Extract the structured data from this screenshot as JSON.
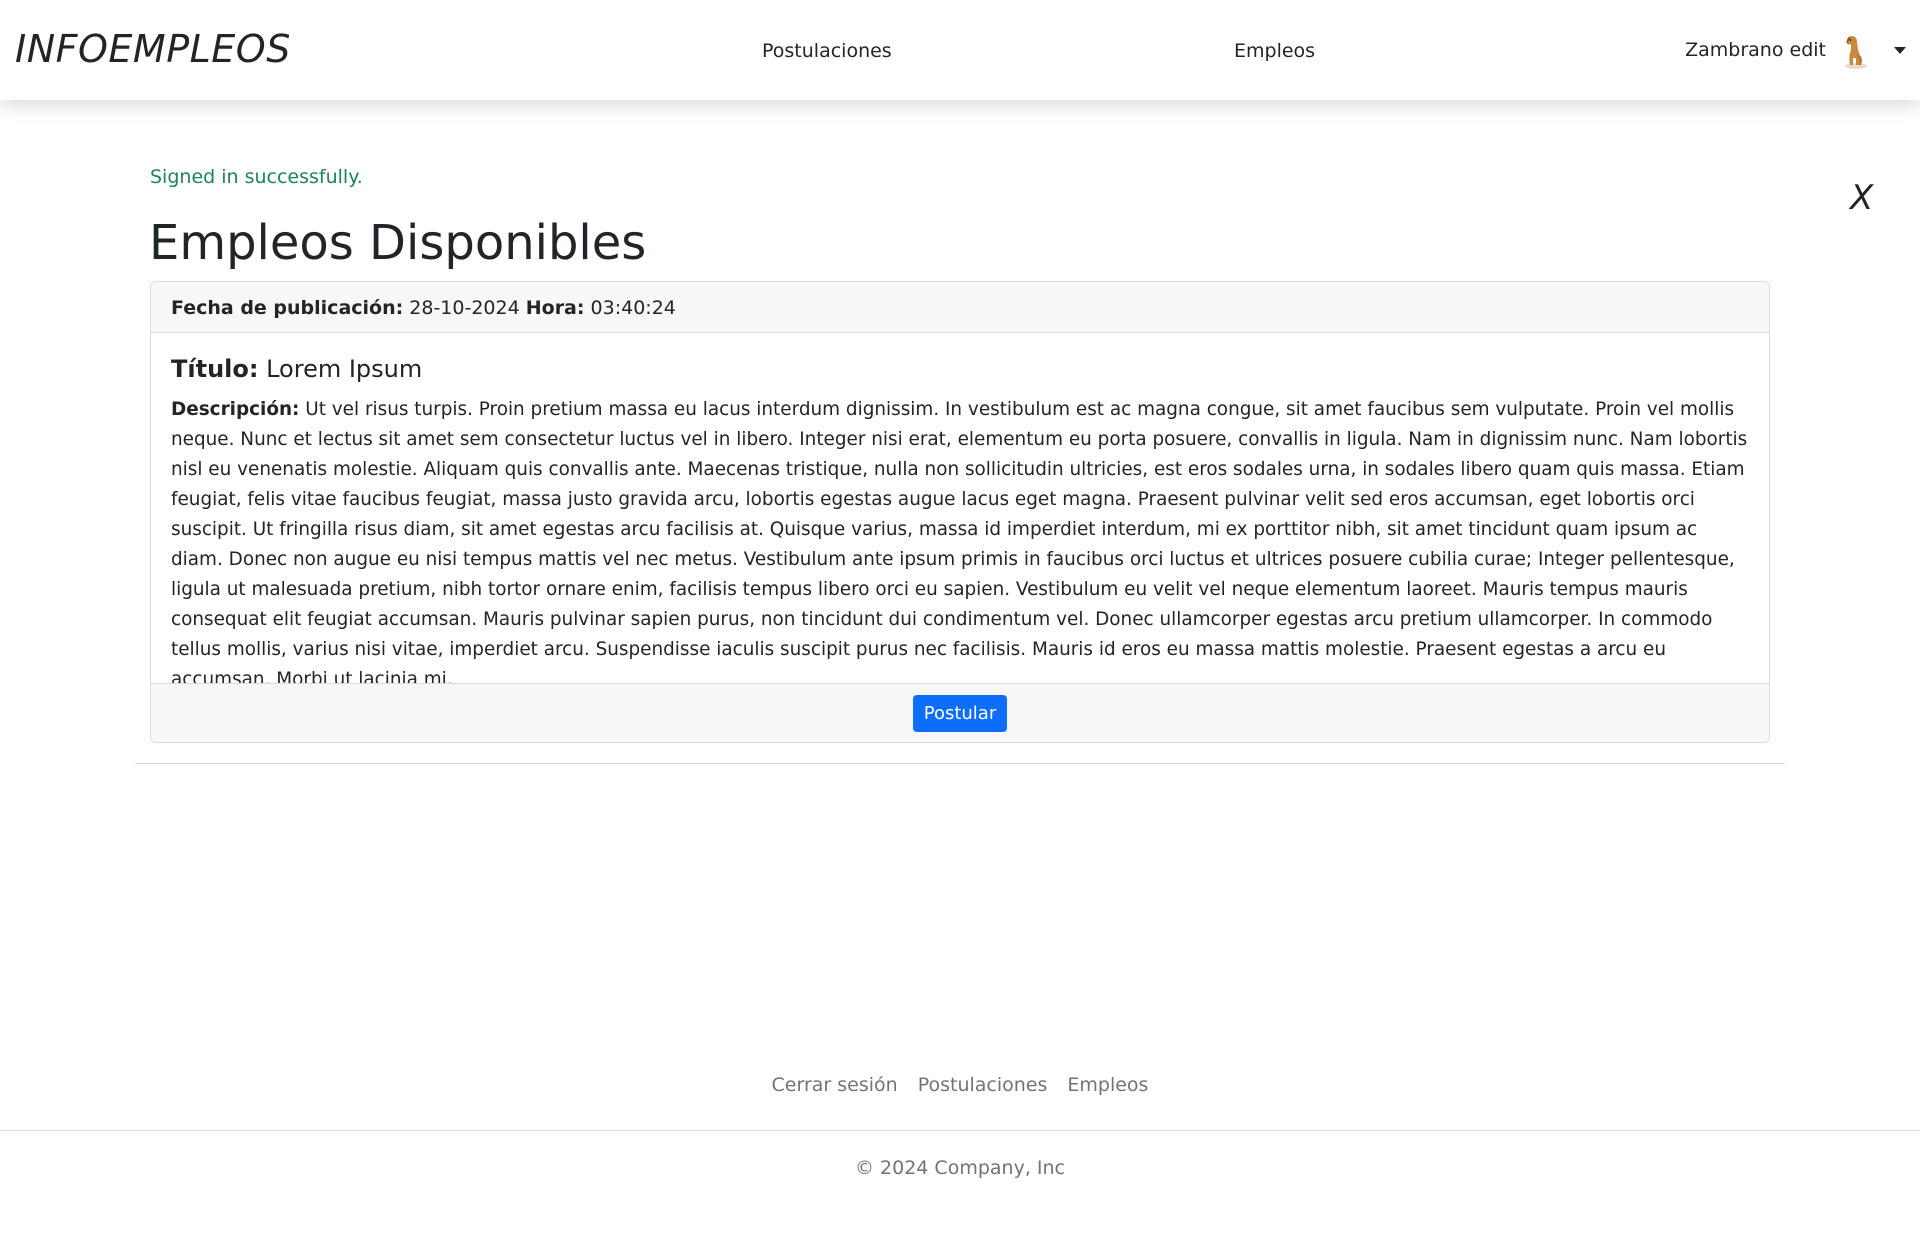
{
  "navbar": {
    "brand": "INFOEMPLEOS",
    "links": [
      "Postulaciones",
      "Empleos"
    ],
    "user_name": "Zambrano edit",
    "avatar_icon": "dog-avatar-icon",
    "caret_icon": "caret-down-icon"
  },
  "flash": {
    "message": "Signed in successfully.",
    "close_label": "X",
    "color": "#198754"
  },
  "page": {
    "title": "Empleos Disponibles"
  },
  "job": {
    "date_label": "Fecha de publicación:",
    "date_value": "28-10-2024",
    "time_label": "Hora:",
    "time_value": "03:40:24",
    "title_label": "Título:",
    "title_value": "Lorem Ipsum",
    "desc_label": "Descripción:",
    "desc_value": "Ut vel risus turpis. Proin pretium massa eu lacus interdum dignissim. In vestibulum est ac magna congue, sit amet faucibus sem vulputate. Proin vel mollis neque. Nunc et lectus sit amet sem consectetur luctus vel in libero. Integer nisi erat, elementum eu porta posuere, convallis in ligula. Nam in dignissim nunc. Nam lobortis nisl eu venenatis molestie. Aliquam quis convallis ante. Maecenas tristique, nulla non sollicitudin ultricies, est eros sodales urna, in sodales libero quam quis massa. Etiam feugiat, felis vitae faucibus feugiat, massa justo gravida arcu, lobortis egestas augue lacus eget magna. Praesent pulvinar velit sed eros accumsan, eget lobortis orci suscipit. Ut fringilla risus diam, sit amet egestas arcu facilisis at. Quisque varius, massa id imperdiet interdum, mi ex porttitor nibh, sit amet tincidunt quam ipsum ac diam. Donec non augue eu nisi tempus mattis vel nec metus. Vestibulum ante ipsum primis in faucibus orci luctus et ultrices posuere cubilia curae; Integer pellentesque, ligula ut malesuada pretium, nibh tortor ornare enim, facilisis tempus libero orci eu sapien. Vestibulum eu velit vel neque elementum laoreet. Mauris tempus mauris consequat elit feugiat accumsan. Mauris pulvinar sapien purus, non tincidunt dui condimentum vel. Donec ullamcorper egestas arcu pretium ullamcorper. In commodo tellus mollis, varius nisi vitae, imperdiet arcu. Suspendisse iaculis suscipit purus nec facilisis. Mauris id eros eu massa mattis molestie. Praesent egestas a arcu eu accumsan. Morbi ut lacinia mi.",
    "apply_label": "Postular",
    "accent_color": "#0d6efd"
  },
  "footer": {
    "links": [
      "Cerrar sesión",
      "Postulaciones",
      "Empleos"
    ],
    "copyright": "© 2024 Company, Inc"
  }
}
